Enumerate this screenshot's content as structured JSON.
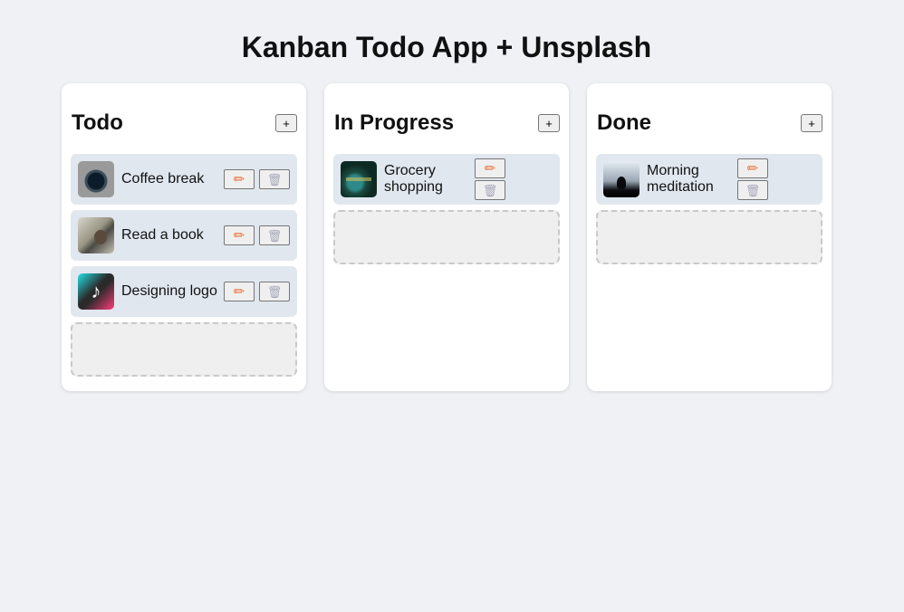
{
  "app": {
    "title": "Kanban Todo App + Unsplash"
  },
  "icons": {
    "add": "+",
    "edit": "pencil-icon",
    "delete": "trash-icon"
  },
  "colors": {
    "edit_icon": "#e8723a",
    "delete_icon": "#a7a7bb",
    "card_bg": "#e1e7ef"
  },
  "columns": [
    {
      "title": "Todo",
      "add_label": "+",
      "cards": [
        {
          "label": "Coffee break",
          "image": "coffee-cup-photo"
        },
        {
          "label": "Read a book",
          "image": "person-reading-photo"
        },
        {
          "label": "Designing logo",
          "image": "tiktok-logo-photo"
        }
      ]
    },
    {
      "title": "In Progress",
      "add_label": "+",
      "cards": [
        {
          "label": "Grocery shopping",
          "image": "grocery-market-photo"
        }
      ]
    },
    {
      "title": "Done",
      "add_label": "+",
      "cards": [
        {
          "label": "Morning meditation",
          "image": "meditation-silhouette-photo"
        }
      ]
    }
  ]
}
